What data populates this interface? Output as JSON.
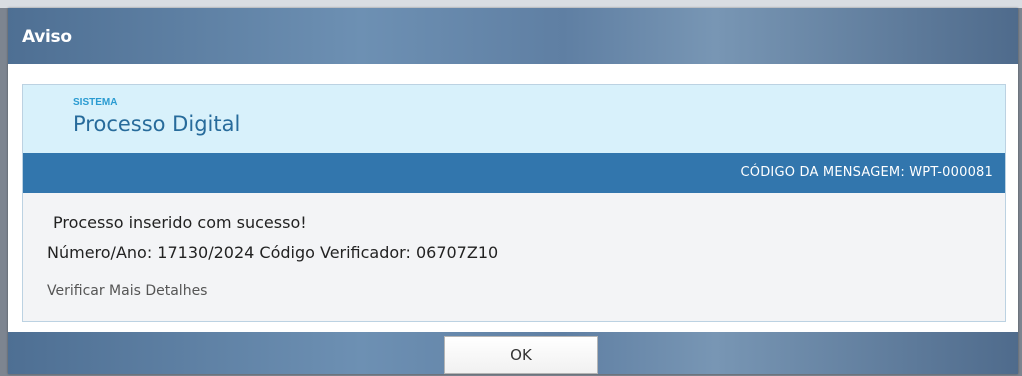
{
  "dialog": {
    "title": "Aviso"
  },
  "panel": {
    "system_label": "SISTEMA",
    "system_name": "Processo Digital",
    "message_code": "CÓDIGO DA MENSAGEM: WPT-000081"
  },
  "message": {
    "line1": "Processo inserido com sucesso!",
    "line2": "Número/Ano: 17130/2024 Código Verificador: 06707Z10",
    "details_link": "Verificar Mais Detalhes"
  },
  "footer": {
    "ok_label": "OK"
  },
  "colors": {
    "titlebar": "#5f7fa3",
    "header_bg": "#d8f1fb",
    "code_bar": "#3276ad",
    "system_label": "#2a9bd1"
  }
}
